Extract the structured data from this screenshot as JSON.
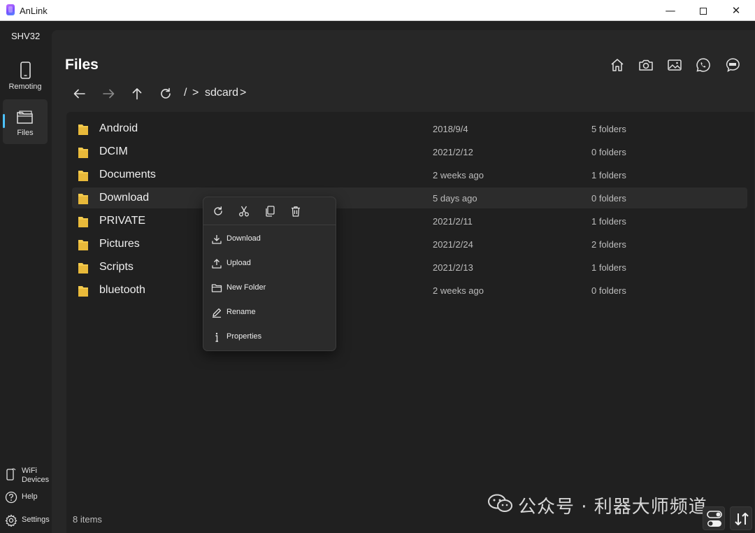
{
  "window": {
    "title": "AnLink",
    "minimize_glyph": "—",
    "close_glyph": "✕"
  },
  "sidebar": {
    "device_name": "SHV32",
    "nav": [
      {
        "label": "Remoting",
        "icon": "phone-icon"
      },
      {
        "label": "Files",
        "icon": "folder-icon",
        "active": true
      }
    ],
    "bottom": [
      {
        "label_line1": "WiFi",
        "label_line2": "Devices",
        "icon": "phone-wifi-icon"
      },
      {
        "label": "Help",
        "icon": "help-icon"
      },
      {
        "label": "Settings",
        "icon": "gear-icon"
      }
    ]
  },
  "header": {
    "title": "Files",
    "shortcuts": [
      "home-icon",
      "camera-icon",
      "image-icon",
      "whatsapp-icon",
      "line-icon"
    ]
  },
  "toolbar": {
    "path_root": "/",
    "separator": ">",
    "path_segment": "sdcard",
    "buttons": [
      "back-arrow-icon",
      "forward-arrow-icon",
      "up-arrow-icon",
      "refresh-icon"
    ]
  },
  "files": [
    {
      "name": "Android",
      "date": "2018/9/4",
      "count": "5 folders"
    },
    {
      "name": "DCIM",
      "date": "2021/2/12",
      "count": "0 folders"
    },
    {
      "name": "Documents",
      "date": "2 weeks ago",
      "count": "1 folders"
    },
    {
      "name": "Download",
      "date": "5 days ago",
      "count": "0 folders",
      "hovered": true
    },
    {
      "name": "PRIVATE",
      "date": "2021/2/11",
      "count": "1 folders"
    },
    {
      "name": "Pictures",
      "date": "2021/2/24",
      "count": "2 folders"
    },
    {
      "name": "Scripts",
      "date": "2021/2/13",
      "count": "1 folders"
    },
    {
      "name": "bluetooth",
      "date": "2 weeks ago",
      "count": "0 folders"
    }
  ],
  "status": {
    "item_count": "8 items"
  },
  "context_menu": {
    "quick_actions": [
      "refresh-icon",
      "cut-icon",
      "copy-icon",
      "delete-icon"
    ],
    "items": [
      {
        "label": "Download",
        "icon": "download-icon"
      },
      {
        "label": "Upload",
        "icon": "upload-icon"
      },
      {
        "label": "New Folder",
        "icon": "new-folder-icon"
      },
      {
        "label": "Rename",
        "icon": "rename-icon"
      },
      {
        "label": "Properties",
        "icon": "info-icon"
      }
    ]
  },
  "watermark": {
    "text": "公众号 · 利器大师频道"
  },
  "colors": {
    "accent": "#4cc2ff",
    "folder": "#f2c94c",
    "background": "#202020",
    "panel": "#272727"
  }
}
